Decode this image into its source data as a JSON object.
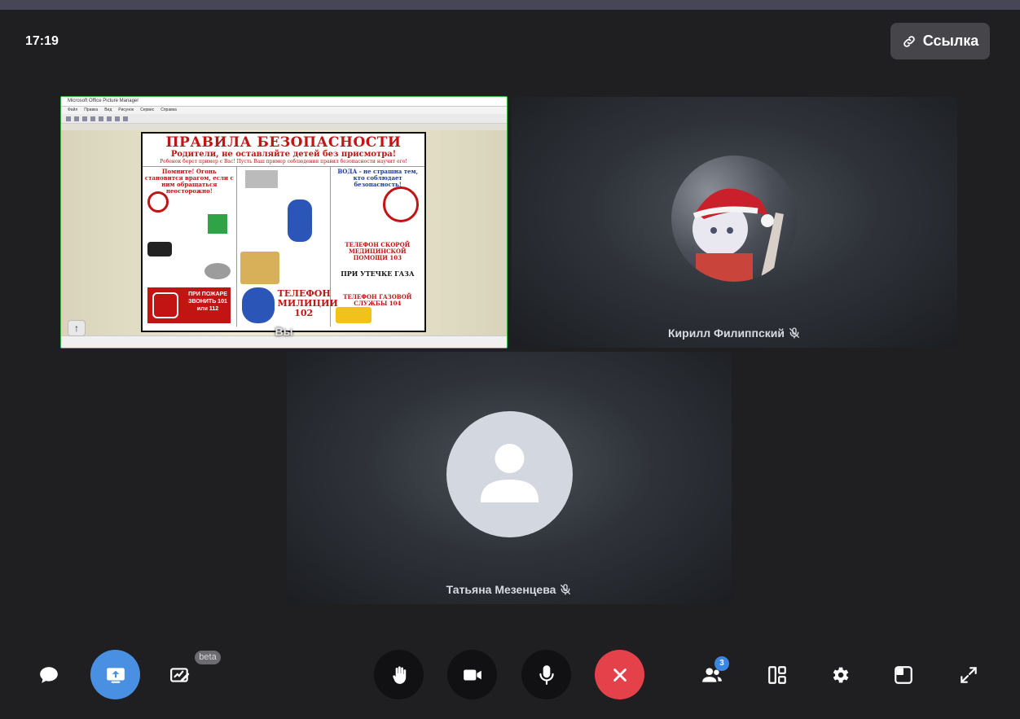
{
  "header": {
    "time": "17:19",
    "link_label": "Ссылка"
  },
  "tiles": {
    "self": {
      "name": "Вы",
      "screen_share": {
        "window_title": "Microsoft Office Picture Manager",
        "menu": [
          "Файл",
          "Правка",
          "Вид",
          "Рисунок",
          "Сервис",
          "Справка"
        ],
        "poster": {
          "title": "ПРАВИЛА БЕЗОПАСНОСТИ",
          "subtitle": "Родители, не оставляйте детей без присмотра!",
          "note": "Ребенок берет пример с Вас! Пусть Ваш пример соблюдения правил безопасности научит его!",
          "fire_heading": "Помните! Огонь становится врагом, если с ним обращаться неосторожно!",
          "fire_call": "ПРИ ПОЖАРЕ ЗВОНИТЬ 101 или 112",
          "police_call": "ТЕЛЕФОН МИЛИЦИИ 102",
          "water_heading": "ВОДА - не страшна тем, кто соблюдает безопасность!",
          "ambulance_call": "ТЕЛЕФОН СКОРОЙ МЕДИЦИНСКОЙ ПОМОЩИ 103",
          "gas_heading": "ПРИ УТЕЧКЕ ГАЗА",
          "gas_call": "ТЕЛЕФОН ГАЗОВОЙ СЛУЖБЫ 104"
        }
      }
    },
    "kirill": {
      "name": "Кирилл Филиппский"
    },
    "tatyana": {
      "name": "Татьяна Мезенцева"
    }
  },
  "controls": {
    "beta_label": "beta",
    "participants_count": "3"
  },
  "colors": {
    "background": "#1f1f21",
    "share_button": "#4a90e2",
    "hangup": "#e4414a",
    "active_border": "#3bb54a"
  }
}
